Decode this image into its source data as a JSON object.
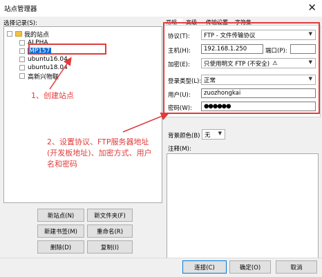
{
  "window": {
    "title": "站点管理器",
    "close_glyph": "✕"
  },
  "tree": {
    "label": "选择记录(S):",
    "root": "我的站点",
    "sites": [
      "ALPHA",
      "MP157",
      "ubuntu16.04",
      "ubuntu18.04",
      "高新兴物联"
    ],
    "selected": "MP157"
  },
  "tabs": [
    "常规",
    "高级",
    "传输设置",
    "字符集"
  ],
  "form": {
    "protocol": {
      "label": "协议(T):",
      "value": "FTP - 文件传输协议"
    },
    "host": {
      "label": "主机(H):",
      "value": "192.168.1.250"
    },
    "port": {
      "label": "端口(P):",
      "value": ""
    },
    "encryption": {
      "label": "加密(E):",
      "value": "只使用明文 FTP (不安全)",
      "warn": "⚠"
    },
    "logon_type": {
      "label": "登录类型(L):",
      "value": "正常"
    },
    "user": {
      "label": "用户(U):",
      "value": "zuozhongkai"
    },
    "password": {
      "label": "密码(W):",
      "value": "●●●●●●"
    }
  },
  "background_color": {
    "label": "背景颜色(B)",
    "value": "无"
  },
  "notes_label": "注释(M):",
  "left_buttons": {
    "new_site": "新站点(N)",
    "new_folder": "新文件夹(F)",
    "new_bookmark": "新建书签(M)",
    "rename": "重命名(R)",
    "delete": "删除(D)",
    "copy": "复制(I)"
  },
  "bottom_buttons": {
    "connect": "连接(C)",
    "ok": "确定(O)",
    "cancel": "取消"
  },
  "annotations": {
    "step1": "1、创建站点",
    "step2": [
      "2、设置协议、FTP服务器地址",
      "(开发板地址)、加密方式、用户",
      "名和密码"
    ]
  },
  "colors": {
    "annotation": "#e23a3a",
    "selection": "#0a6cd6",
    "accent": "#0078d7"
  }
}
